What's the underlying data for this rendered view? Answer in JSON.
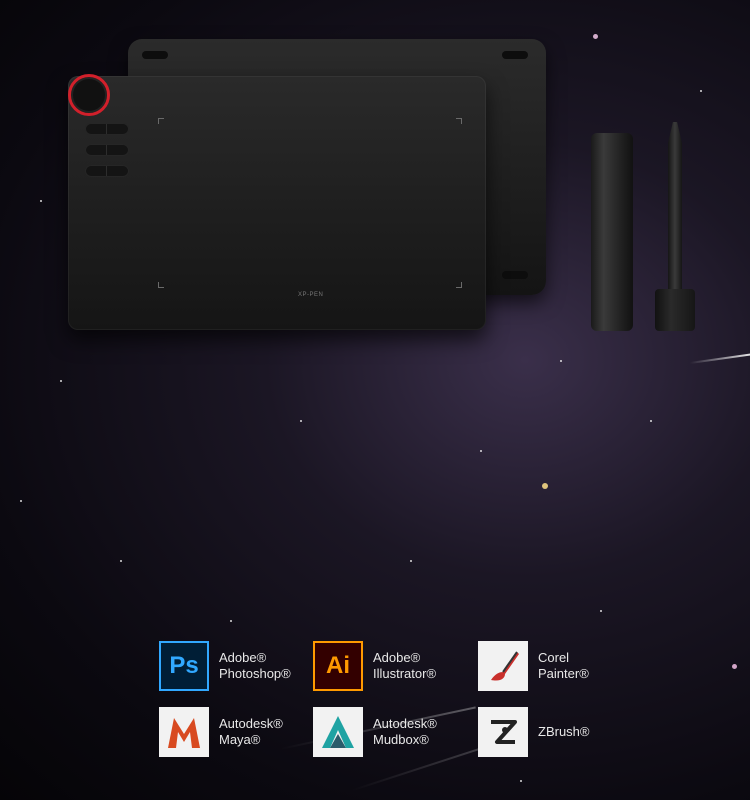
{
  "product": {
    "brand_logo": "XP-PEN"
  },
  "software": [
    {
      "name_line1": "Adobe®",
      "name_line2": "Photoshop®",
      "icon": "photoshop-icon",
      "icon_text": "Ps",
      "color": "#31a8ff",
      "bg": "#001e36"
    },
    {
      "name_line1": "Adobe®",
      "name_line2": "Illustrator®",
      "icon": "illustrator-icon",
      "icon_text": "Ai",
      "color": "#ff9a00",
      "bg": "#330000"
    },
    {
      "name_line1": "Corel",
      "name_line2": "Painter®",
      "icon": "corel-painter-icon",
      "icon_text": "",
      "color": "#c9302c",
      "bg": "#f2f2f2"
    },
    {
      "name_line1": "Autodesk®",
      "name_line2": "Maya®",
      "icon": "maya-icon",
      "icon_text": "",
      "color": "#d84a20",
      "bg": "#f2f2f2"
    },
    {
      "name_line1": "Autodesk®",
      "name_line2": "Mudbox®",
      "icon": "mudbox-icon",
      "icon_text": "",
      "color": "#1fa3a3",
      "bg": "#f2f2f2"
    },
    {
      "name_line1": "ZBrush®",
      "name_line2": "",
      "icon": "zbrush-icon",
      "icon_text": "",
      "color": "#222222",
      "bg": "#f2f2f2"
    }
  ]
}
